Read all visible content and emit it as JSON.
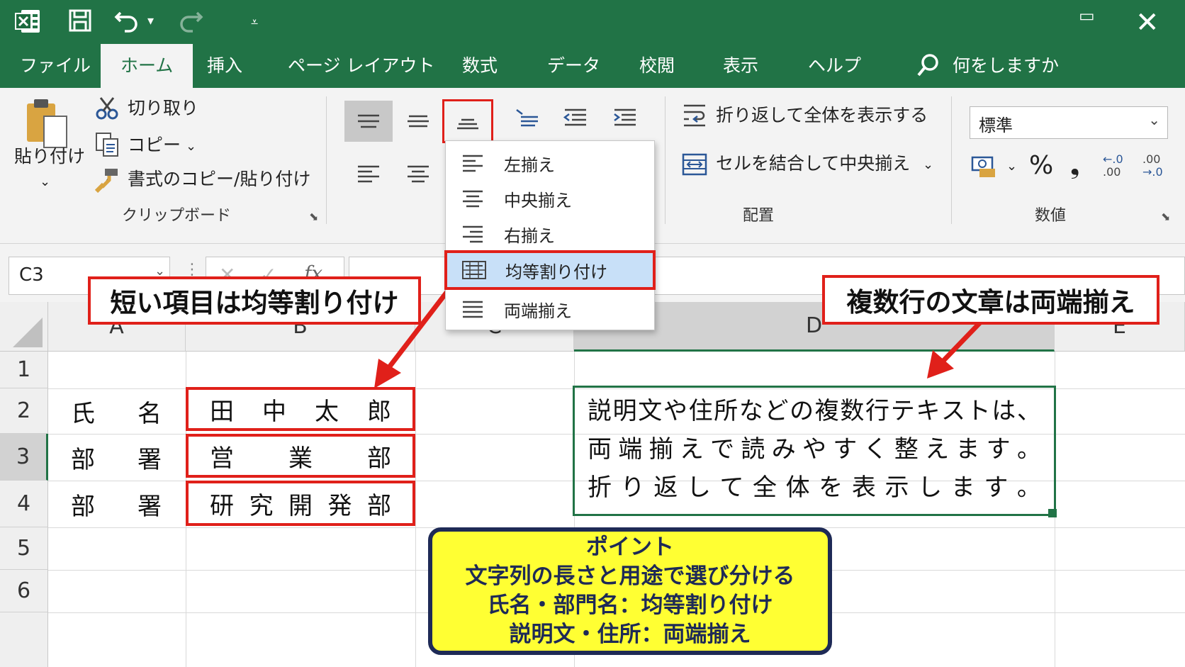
{
  "tabs": [
    "ファイル",
    "ホーム",
    "挿入",
    "ページ レイアウト",
    "数式",
    "データ",
    "校閲",
    "表示",
    "ヘルプ"
  ],
  "active_tab": "ホーム",
  "search_label": "何をしますか",
  "clipboard": {
    "paste_label": "貼り付け",
    "cut_label": "切り取り",
    "copy_label": "コピー",
    "format_painter_label": "書式のコピー/貼り付け",
    "group_label": "クリップボード"
  },
  "alignment": {
    "wrap_label": "折り返して全体を表示する",
    "merge_label": "セルを結合して中央揃え",
    "group_label": "配置"
  },
  "number": {
    "format_value": "標準",
    "percent_symbol": "%",
    "comma_symbol": "❟",
    "inc_decimal": ".00",
    "dec_decimal": ".0",
    "group_label": "数値"
  },
  "formula_bar": {
    "name_box": "C3",
    "fx": "fx"
  },
  "menu_items": [
    "左揃え",
    "中央揃え",
    "右揃え",
    "均等割り付け",
    "両端揃え"
  ],
  "highlighted_menu_item": "均等割り付け",
  "columns": [
    "A",
    "B",
    "C",
    "D",
    "E"
  ],
  "rows": [
    "1",
    "2",
    "3",
    "4",
    "5",
    "6"
  ],
  "cells": {
    "A2": [
      "氏",
      "名"
    ],
    "A3": [
      "部",
      "署"
    ],
    "A4": [
      "部",
      "署"
    ],
    "B2": [
      "田",
      "中",
      "太",
      "郎"
    ],
    "B3": [
      "営",
      "業",
      "部"
    ],
    "B4": [
      "研",
      "究",
      "開",
      "発",
      "部"
    ]
  },
  "d_text_lines": [
    [
      "説",
      "明",
      "文",
      "や",
      "住",
      "所",
      "な",
      "ど",
      "の",
      "複",
      "数",
      "行",
      "テ",
      "キ",
      "ス",
      "ト",
      "は",
      "、"
    ],
    [
      "両",
      "端",
      "揃",
      "え",
      "で",
      "読",
      "み",
      "や",
      "す",
      "く",
      "整",
      "え",
      "ま",
      "す",
      "。"
    ],
    [
      "折",
      "り",
      "返",
      "し",
      "て",
      "全",
      "体",
      "を",
      "表",
      "示",
      "し",
      "ま",
      "す",
      "。"
    ]
  ],
  "callouts": {
    "left": "短い項目は均等割り付け",
    "right": "複数行の文章は両端揃え"
  },
  "point": {
    "title": "ポイント",
    "lines": [
      "文字列の長さと用途で選び分ける",
      "氏名・部門名：均等割り付け",
      "説明文・住所：両端揃え"
    ]
  },
  "colors": {
    "excel_green": "#217346",
    "highlight_red": "#e0201a",
    "point_yellow": "#ffff33",
    "point_navy": "#1e2a56"
  }
}
